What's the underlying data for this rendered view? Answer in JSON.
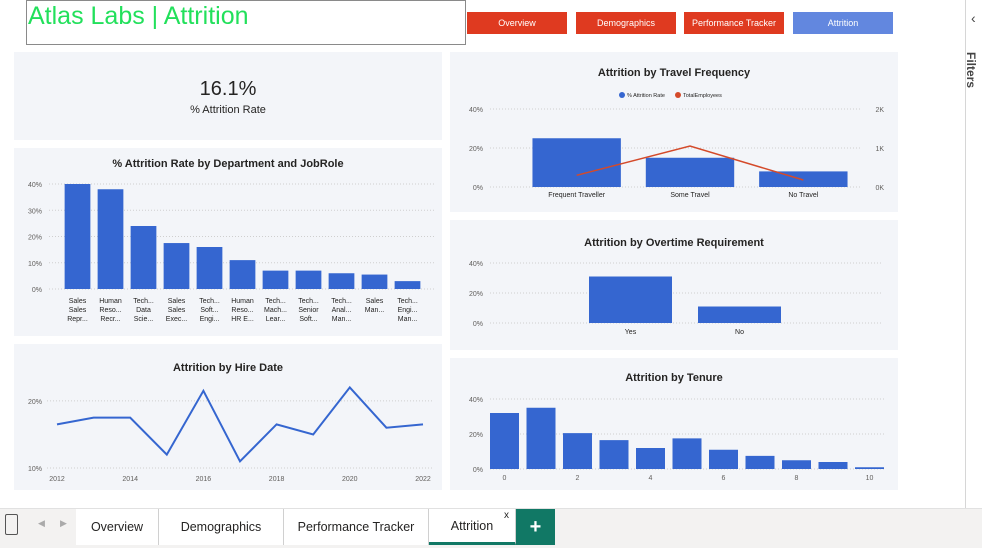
{
  "report": {
    "title": "Atlas Labs | Attrition",
    "nav": [
      {
        "label": "Overview",
        "color": "#df3a20"
      },
      {
        "label": "Demographics",
        "color": "#df3a20"
      },
      {
        "label": "Performance Tracker",
        "color": "#df3a20"
      },
      {
        "label": "Attrition",
        "color": "#6287df"
      }
    ]
  },
  "kpi": {
    "value": "16.1%",
    "label": "% Attrition Rate"
  },
  "colors": {
    "bar": "#3566d0",
    "line_red": "#d44a2a",
    "accent_green": "#22e05b",
    "tab_green": "#117865"
  },
  "side_pane": {
    "label": "Filters",
    "collapse_icon": "chevron-left-icon"
  },
  "tabs": {
    "items": [
      "Overview",
      "Demographics",
      "Performance Tracker",
      "Attrition"
    ],
    "active": "Attrition",
    "close_label": "x",
    "add_label": "+"
  },
  "chart_data": [
    {
      "id": "dept",
      "type": "bar",
      "title": "% Attrition Rate by Department and JobRole",
      "categories": [
        [
          "Sales",
          "Sales",
          "Repr..."
        ],
        [
          "Human",
          "Reso...",
          "Recr..."
        ],
        [
          "Tech...",
          "Data",
          "Scie..."
        ],
        [
          "Sales",
          "Sales",
          "Exec..."
        ],
        [
          "Tech...",
          "Soft...",
          "Engi..."
        ],
        [
          "Human",
          "Reso...",
          "HR E..."
        ],
        [
          "Tech...",
          "Mach...",
          "Lear..."
        ],
        [
          "Tech...",
          "Senior",
          "Soft..."
        ],
        [
          "Tech...",
          "Anal...",
          "Man..."
        ],
        [
          "Sales",
          "Man...",
          ""
        ],
        [
          "Tech...",
          "Engi...",
          "Man..."
        ]
      ],
      "values": [
        40,
        38,
        24,
        17.5,
        16,
        11,
        7,
        7,
        6,
        5.5,
        3
      ],
      "ylim": [
        0,
        40
      ],
      "yticks": [
        "0%",
        "10%",
        "20%",
        "30%",
        "40%"
      ],
      "grid": true
    },
    {
      "id": "hire",
      "type": "line",
      "title": "Attrition by Hire Date",
      "x": [
        2012,
        2013,
        2014,
        2015,
        2016,
        2017,
        2018,
        2019,
        2020,
        2021,
        2022
      ],
      "values": [
        16.5,
        17.5,
        17.5,
        12,
        21.5,
        11,
        16.5,
        15,
        22,
        16,
        16.5
      ],
      "ylim": [
        10,
        24
      ],
      "yticks": [
        "10%",
        "20%"
      ],
      "xticks": [
        "2012",
        "2014",
        "2016",
        "2018",
        "2020",
        "2022"
      ],
      "grid": true
    },
    {
      "id": "travel",
      "type": "bar",
      "title": "Attrition by Travel Frequency",
      "categories": [
        "Frequent Traveller",
        "Some Travel",
        "No Travel"
      ],
      "series": [
        {
          "name": "% Attrition Rate",
          "values": [
            25,
            15,
            8
          ],
          "color": "#3566d0"
        },
        {
          "name": "TotalEmployees",
          "values": [
            300,
            1050,
            180
          ],
          "color": "#d44a2a"
        }
      ],
      "ylim": [
        0,
        40
      ],
      "yticks": [
        "0%",
        "20%",
        "40%"
      ],
      "y2lim": [
        0,
        2000
      ],
      "y2ticks": [
        "0K",
        "1K",
        "2K"
      ],
      "legend": "top-center",
      "grid": true
    },
    {
      "id": "overtime",
      "type": "bar",
      "title": "Attrition by Overtime Requirement",
      "categories": [
        "Yes",
        "No"
      ],
      "values": [
        31,
        11
      ],
      "ylim": [
        0,
        40
      ],
      "yticks": [
        "0%",
        "20%",
        "40%"
      ],
      "grid": true
    },
    {
      "id": "tenure",
      "type": "bar",
      "title": "Attrition by Tenure",
      "categories": [
        0,
        1,
        2,
        3,
        4,
        5,
        6,
        7,
        8,
        9,
        10
      ],
      "values": [
        32,
        35,
        20.5,
        16.5,
        12,
        17.5,
        11,
        7.5,
        5,
        4,
        1
      ],
      "ylim": [
        0,
        40
      ],
      "yticks": [
        "0%",
        "20%",
        "40%"
      ],
      "xticks": [
        "0",
        "2",
        "4",
        "6",
        "8",
        "10"
      ],
      "grid": true
    }
  ]
}
